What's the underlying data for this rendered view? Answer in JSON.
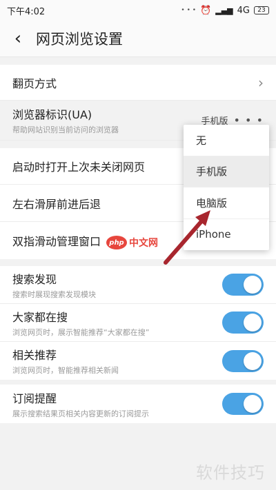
{
  "status_bar": {
    "time": "下午4:02",
    "dots": "• • •",
    "signal": "4G",
    "battery": "23"
  },
  "header": {
    "back_icon": "‹",
    "title": "网页浏览设置"
  },
  "group1": {
    "page_turn": {
      "label": "翻页方式",
      "chevron": "›"
    },
    "browser_ua": {
      "label": "浏览器标识(UA)",
      "desc": "帮助网站识别当前访问的浏览器",
      "value": "手机版",
      "more": "• • •"
    }
  },
  "group2": {
    "restore_tabs": {
      "label": "启动时打开上次未关闭网页"
    },
    "swipe_nav": {
      "label": "左右滑屏前进后退"
    },
    "two_finger": {
      "label": "双指滑动管理窗口"
    }
  },
  "group3": {
    "search_discover": {
      "label": "搜索发现",
      "desc": "搜索时展现搜索发现模块",
      "on": true
    },
    "everyone_search": {
      "label": "大家都在搜",
      "desc": "浏览网页时，展示智能推荐“大家都在搜”",
      "on": true
    },
    "related": {
      "label": "相关推荐",
      "desc": "浏览网页时，智能推荐相关新闻",
      "on": true
    }
  },
  "group4": {
    "subscribe": {
      "label": "订阅提醒",
      "desc": "展示搜索结果页相关内容更新的订阅提示",
      "on": true
    }
  },
  "popup": {
    "options": [
      "无",
      "手机版",
      "电脑版",
      "iPhone"
    ],
    "selected": "手机版"
  },
  "watermarks": {
    "php_badge": "php",
    "php_text": "中文网",
    "site": "软件技巧"
  },
  "colors": {
    "toggle_on": "#4aa3e4",
    "arrow": "#a8262e",
    "php_red": "#e7463d"
  }
}
